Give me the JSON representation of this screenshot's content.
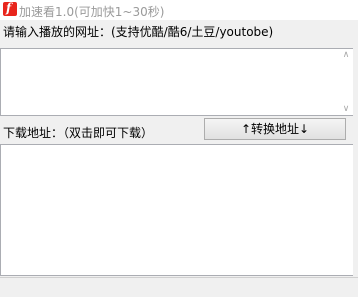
{
  "window": {
    "title": "加速看1.0(可加快1~30秒)"
  },
  "url_section": {
    "label": "请输入播放的网址：(支持优酷/酷6/土豆/youtobe)",
    "value": ""
  },
  "download_section": {
    "label": "下载地址：（双击即可下载）",
    "convert_button": "↑转换地址↓"
  },
  "colors": {
    "title_text": "#9a9a9a",
    "icon": "#e8251c",
    "client_bg": "#f0f0f0"
  },
  "icons": {
    "app_icon": "flash-icon"
  }
}
